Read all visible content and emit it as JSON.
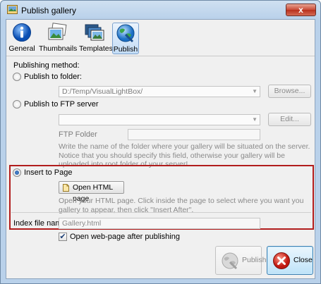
{
  "window": {
    "title": "Publish gallery",
    "close_glyph": "x"
  },
  "toolbar": {
    "items": [
      {
        "label": "General",
        "icon": "info-icon",
        "active": false
      },
      {
        "label": "Thumbnails",
        "icon": "photos-icon",
        "active": false
      },
      {
        "label": "Templates",
        "icon": "templates-icon",
        "active": false
      },
      {
        "label": "Publish",
        "icon": "globe-publish-icon",
        "active": true
      }
    ]
  },
  "publishing": {
    "method_label": "Publishing method:",
    "folder": {
      "label": "Publish to folder:",
      "selected": false,
      "path_value": "D:/Temp/VisualLightBox/",
      "browse_label": "Browse..."
    },
    "ftp": {
      "label": "Publish to FTP server",
      "selected": false,
      "server_value": "",
      "edit_label": "Edit...",
      "folder_label": "FTP Folder",
      "folder_value": "",
      "description": "Write the name of the folder where your gallery will be situated on the server. Notice that you should specify this field, otherwise your gallery will be uploaded into root folder of your server!"
    },
    "insert": {
      "label": "Insert to Page",
      "selected": true,
      "open_button_label": "Open HTML page",
      "description": "Open your HTML page. Click inside the page to select where you want you gallery to appear, then click \"Insert After\"."
    },
    "index_file": {
      "label": "Index file name",
      "value": "Gallery.html"
    },
    "open_after": {
      "label": "Open web-page after publishing",
      "checked": true
    }
  },
  "footer": {
    "publish_label": "Publish",
    "close_label": "Close"
  },
  "colors": {
    "highlight_border": "#b11d1d",
    "accent": "#3c7fb1"
  }
}
